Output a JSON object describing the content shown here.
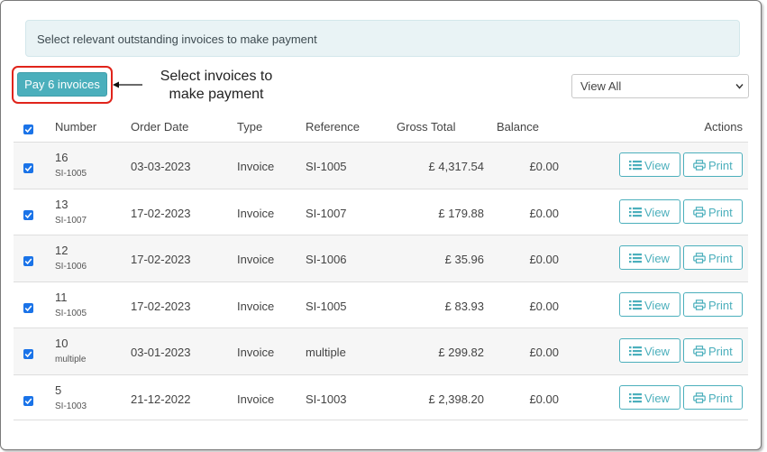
{
  "info": {
    "text": "Select relevant outstanding invoices to make payment"
  },
  "pay_button": {
    "label": "Pay 6 invoices"
  },
  "annotation": {
    "line1": "Select invoices to",
    "line2": "make payment"
  },
  "filter": {
    "selected": "View All"
  },
  "headers": {
    "number": "Number",
    "order_date": "Order Date",
    "type": "Type",
    "reference": "Reference",
    "gross_total": "Gross Total",
    "balance": "Balance",
    "actions": "Actions"
  },
  "buttons": {
    "view": "View",
    "print": "Print"
  },
  "rows": [
    {
      "number": "16",
      "sub": "SI-1005",
      "date": "03-03-2023",
      "type": "Invoice",
      "reference": "SI-1005",
      "gross": "£ 4,317.54",
      "balance": "£0.00"
    },
    {
      "number": "13",
      "sub": "SI-1007",
      "date": "17-02-2023",
      "type": "Invoice",
      "reference": "SI-1007",
      "gross": "£ 179.88",
      "balance": "£0.00"
    },
    {
      "number": "12",
      "sub": "SI-1006",
      "date": "17-02-2023",
      "type": "Invoice",
      "reference": "SI-1006",
      "gross": "£ 35.96",
      "balance": "£0.00"
    },
    {
      "number": "11",
      "sub": "SI-1005",
      "date": "17-02-2023",
      "type": "Invoice",
      "reference": "SI-1005",
      "gross": "£ 83.93",
      "balance": "£0.00"
    },
    {
      "number": "10",
      "sub": "multiple",
      "date": "03-01-2023",
      "type": "Invoice",
      "reference": "multiple",
      "gross": "£ 299.82",
      "balance": "£0.00"
    },
    {
      "number": "5",
      "sub": "SI-1003",
      "date": "21-12-2022",
      "type": "Invoice",
      "reference": "SI-1003",
      "gross": "£ 2,398.20",
      "balance": "£0.00"
    }
  ],
  "colors": {
    "accent": "#4bafbc",
    "checkbox": "#1a73e8",
    "highlight": "#e0241b"
  }
}
